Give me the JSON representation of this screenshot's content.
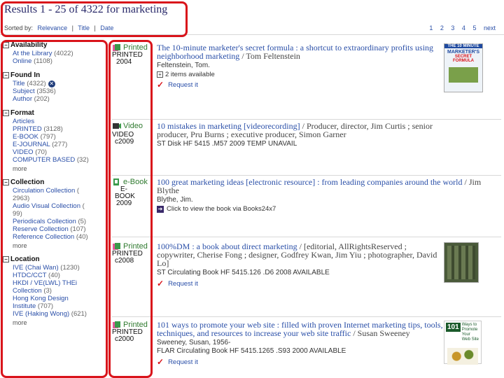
{
  "header": {
    "title": "Results 1 - 25 of 4322 for marketing",
    "sorted_by": "Sorted by:",
    "sort_relevance": "Relevance",
    "sort_title": "Title",
    "sort_date": "Date",
    "sep": "|",
    "pages": [
      "1",
      "2",
      "3",
      "4",
      "5",
      "next"
    ]
  },
  "facets": {
    "availability": {
      "head": "Availability",
      "items": [
        {
          "label": "At the Library",
          "count": "(4022)"
        },
        {
          "label": "Online",
          "count": "(1108)"
        }
      ]
    },
    "found_in": {
      "head": "Found In",
      "items": [
        {
          "label": "Title",
          "count": "(4322)"
        },
        {
          "label": "Subject",
          "count": "(3536)"
        },
        {
          "label": "Author",
          "count": "(202)"
        }
      ]
    },
    "format": {
      "head": "Format",
      "items": [
        {
          "label": "Articles",
          "count": ""
        },
        {
          "label": "PRINTED",
          "count": "(3128)"
        },
        {
          "label": "E-BOOK",
          "count": "(797)"
        },
        {
          "label": "E-JOURNAL",
          "count": "(277)"
        },
        {
          "label": "VIDEO",
          "count": "(70)"
        },
        {
          "label": "COMPUTER BASED",
          "count": "(32)"
        }
      ],
      "more": "more"
    },
    "collection": {
      "head": "Collection",
      "items": [
        {
          "label": "Circulation Collection",
          "count": "("
        },
        {
          "label": "2963)",
          "count": ""
        },
        {
          "label": "Audio Visual Collection",
          "count": "("
        },
        {
          "label": "99)",
          "count": ""
        },
        {
          "label": "Periodicals Collection",
          "count": "(5)"
        },
        {
          "label": "Reserve Collection",
          "count": "(107)"
        },
        {
          "label": "Reference Collection",
          "count": "(40)"
        }
      ],
      "more": "more"
    },
    "location": {
      "head": "Location",
      "items": [
        {
          "label": "IVE (Chai Wan)",
          "count": "(1230)"
        },
        {
          "label": "HTDC/CCT",
          "count": "(40)"
        },
        {
          "label": "HKDI / VE(LWL) THEi",
          "count": ""
        },
        {
          "label": "Collection",
          "count": "(3)"
        },
        {
          "label": "Hong Kong Design",
          "count": ""
        },
        {
          "label": "Institute",
          "count": "(707)"
        },
        {
          "label": "IVE (Haking Wong)",
          "count": "(621)"
        }
      ],
      "more": "more"
    }
  },
  "results": [
    {
      "format_label": "Printed",
      "format_text": [
        "PRINTED",
        "2004"
      ],
      "title": "The 10-minute marketer's secret formula : a shortcut to extraordinary profits using neighborhood marketing",
      "resp": "/ Tom Feltenstein",
      "meta": [
        "Feltenstein, Tom."
      ],
      "sub": "2 items available",
      "sub_icon": "plus",
      "request": "Request it",
      "cover": {
        "top": "THE 10 MINUTE",
        "mid": "MARKETER'S",
        "bot": "SECRET FORMULA"
      }
    },
    {
      "format_label": "Video",
      "format_text": [
        "VIDEO",
        "c2009"
      ],
      "title": "10 mistakes in marketing [videorecording]",
      "resp": "/ Producer, director, Jim Curtis ; senior producer, Pru Burns ; executive producer, Simon Garner",
      "meta": [
        "ST Disk HF 5415 .M57 2009    TEMP UNAVAIL"
      ],
      "sub": "",
      "sub_icon": "",
      "request": ""
    },
    {
      "format_label": "e-Book",
      "format_text": [
        "E-",
        "BOOK",
        "2009"
      ],
      "title": "100 great marketing ideas [electronic resource] : from leading companies around the world",
      "resp": "/ Jim Blythe",
      "meta": [
        "Blythe, Jim."
      ],
      "sub": "Click to view the book via Books24x7",
      "sub_icon": "arrow",
      "request": ""
    },
    {
      "format_label": "Printed",
      "format_text": [
        "PRINTED",
        "c2008"
      ],
      "title": "100%DM : a book about direct marketing",
      "resp": "/ [editorial, AllRightsReserved ; copywriter, Cherise Fong ; designer, Godfrey Kwan, Jim Yiu ; photographer, David Lo]",
      "meta": [
        "ST Circulating Book HF 5415.126 .D6 2008    AVAILABLE"
      ],
      "sub": "",
      "sub_icon": "",
      "request": "Request it"
    },
    {
      "format_label": "Printed",
      "format_text": [
        "PRINTED",
        "c2000"
      ],
      "title": "101 ways to promote your web site : filled with proven Internet marketing tips, tools, techniques, and resources to increase your web site traffic",
      "resp": "/ Susan Sweeney",
      "meta": [
        "Sweeney, Susan, 1956-",
        "FLAR Circulating Book HF 5415.1265 .S93 2000    AVAILABLE"
      ],
      "sub": "",
      "sub_icon": "",
      "request": "Request it",
      "cover": {
        "top": "101",
        "mid": "Ways to Promote Your Web Site",
        "bot": ""
      }
    }
  ]
}
